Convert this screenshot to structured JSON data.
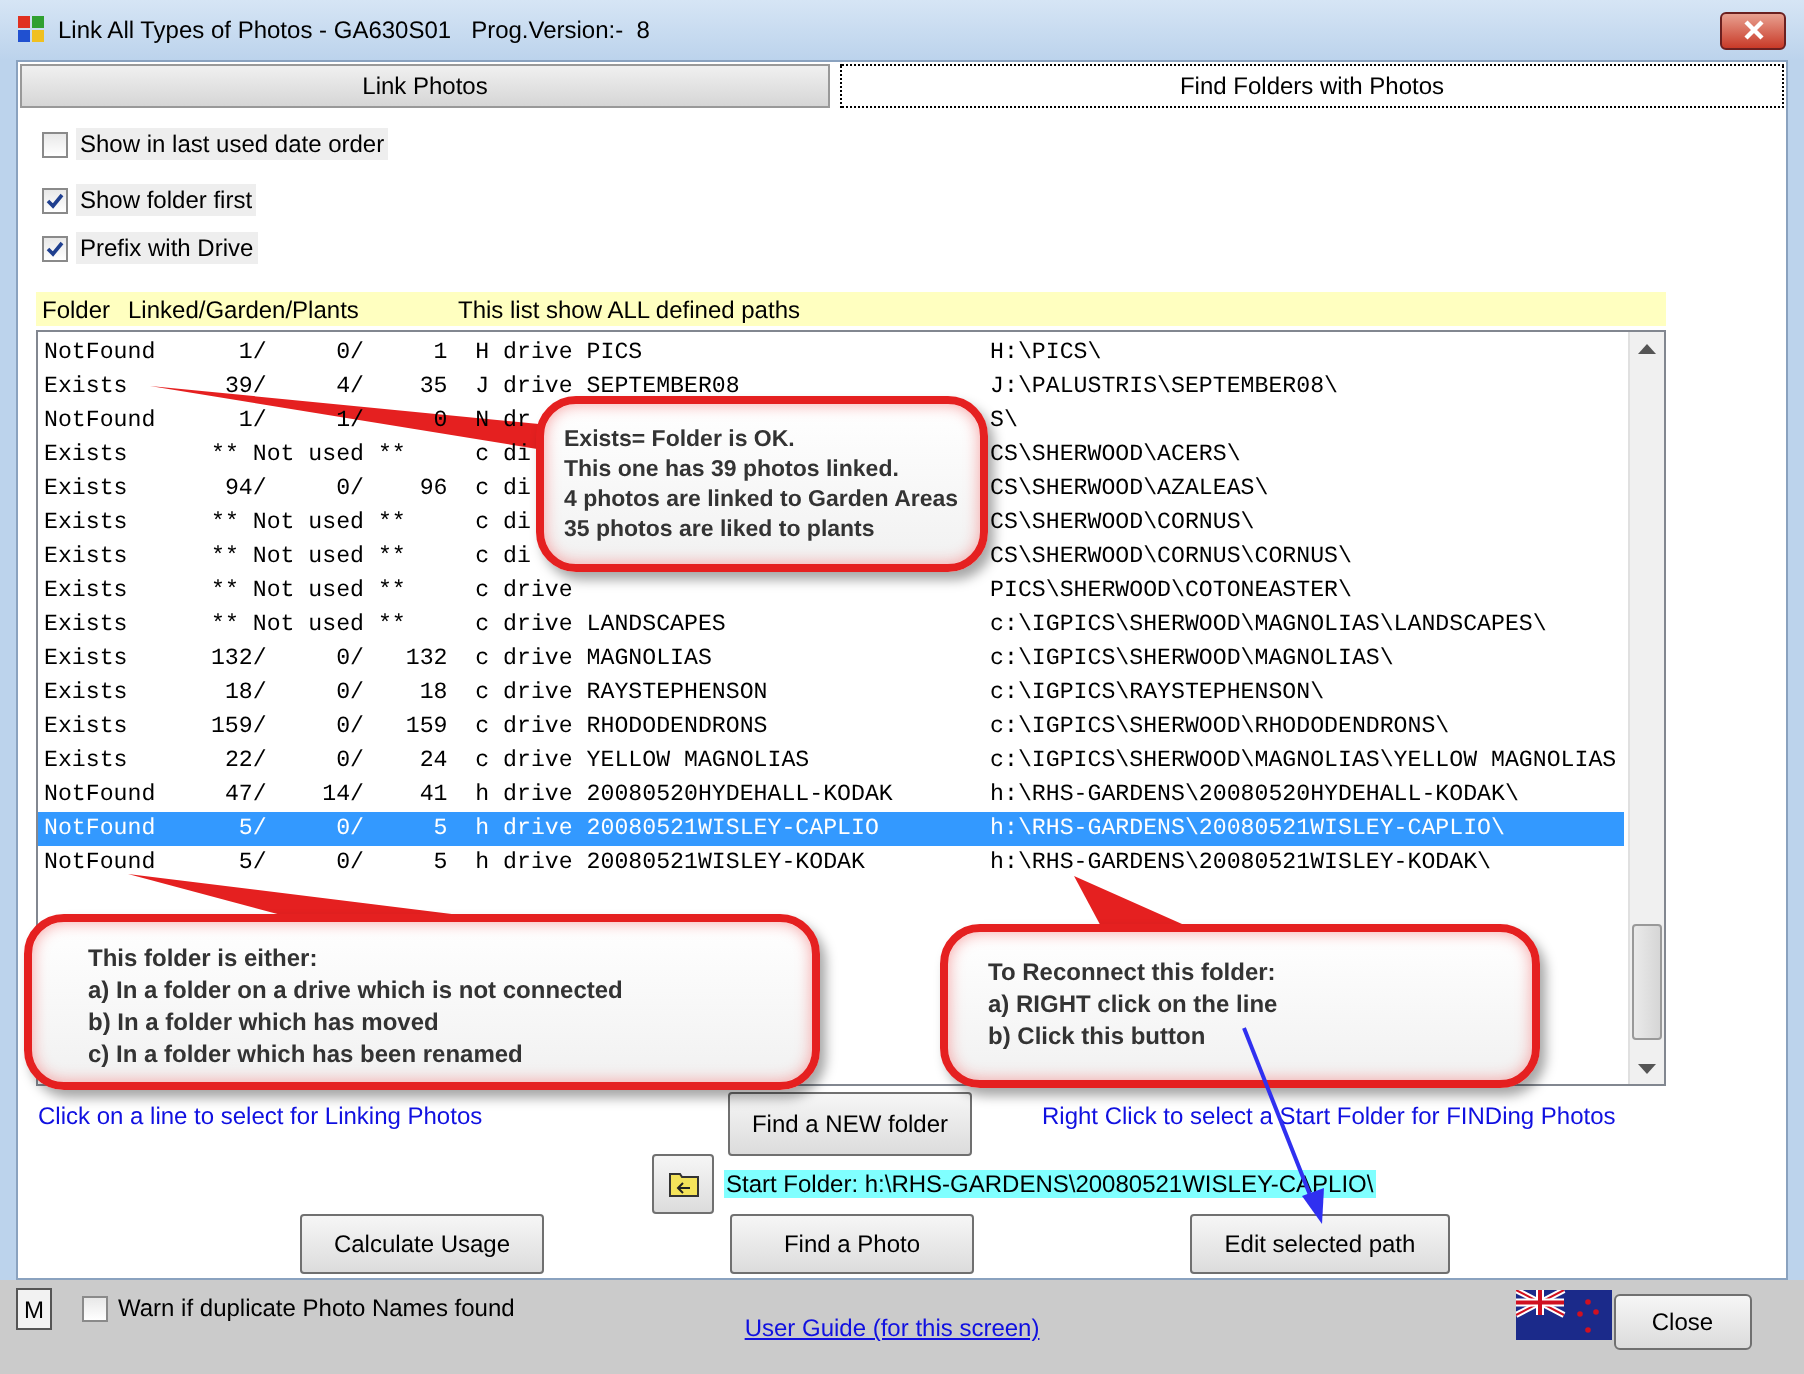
{
  "window": {
    "title": "Link All Types of Photos - GA630S01   Prog.Version:-  8"
  },
  "tabs": [
    {
      "label": "Link Photos",
      "selected": false
    },
    {
      "label": "Find Folders with Photos",
      "selected": true
    }
  ],
  "options": [
    {
      "label": "Show in last used date order",
      "checked": false
    },
    {
      "label": "Show folder first",
      "checked": true
    },
    {
      "label": "Prefix with Drive",
      "checked": true
    }
  ],
  "list_header": [
    "Folder",
    "Linked/Garden/Plants",
    "This list show ALL defined paths"
  ],
  "rows": [
    {
      "status": "NotFound",
      "linked": "1/",
      "garden": "0/",
      "plants": "1",
      "drive": "H drive",
      "folder": "PICS",
      "path": "H:\\PICS\\",
      "selected": false
    },
    {
      "status": "Exists",
      "linked": "39/",
      "garden": "4/",
      "plants": "35",
      "drive": "J drive",
      "folder": "SEPTEMBER08",
      "path": "J:\\PALUSTRIS\\SEPTEMBER08\\",
      "selected": false
    },
    {
      "status": "NotFound",
      "linked": "1/",
      "garden": "1/",
      "plants": "0",
      "drive": "N dr",
      "path": "S\\",
      "selected": false
    },
    {
      "status": "Exists",
      "note": "** Not used **",
      "drive": "c di",
      "path": "CS\\SHERWOOD\\ACERS\\",
      "selected": false
    },
    {
      "status": "Exists",
      "linked": "94/",
      "garden": "0/",
      "plants": "96",
      "drive": "c di",
      "path": "CS\\SHERWOOD\\AZALEAS\\",
      "selected": false
    },
    {
      "status": "Exists",
      "note": "** Not used **",
      "drive": "c di",
      "path": "CS\\SHERWOOD\\CORNUS\\",
      "selected": false
    },
    {
      "status": "Exists",
      "note": "** Not used **",
      "drive": "c di",
      "path": "CS\\SHERWOOD\\CORNUS\\CORNUS\\",
      "selected": false
    },
    {
      "status": "Exists",
      "note": "** Not used **",
      "drive": "c drive",
      "path": "PICS\\SHERWOOD\\COTONEASTER\\",
      "selected": false
    },
    {
      "status": "Exists",
      "note": "** Not used **",
      "drive": "c drive",
      "folder": "LANDSCAPES",
      "path": "c:\\IGPICS\\SHERWOOD\\MAGNOLIAS\\LANDSCAPES\\",
      "selected": false
    },
    {
      "status": "Exists",
      "linked": "132/",
      "garden": "0/",
      "plants": "132",
      "drive": "c drive",
      "folder": "MAGNOLIAS",
      "path": "c:\\IGPICS\\SHERWOOD\\MAGNOLIAS\\",
      "selected": false
    },
    {
      "status": "Exists",
      "linked": "18/",
      "garden": "0/",
      "plants": "18",
      "drive": "c drive",
      "folder": "RAYSTEPHENSON",
      "path": "c:\\IGPICS\\RAYSTEPHENSON\\",
      "selected": false
    },
    {
      "status": "Exists",
      "linked": "159/",
      "garden": "0/",
      "plants": "159",
      "drive": "c drive",
      "folder": "RHODODENDRONS",
      "path": "c:\\IGPICS\\SHERWOOD\\RHODODENDRONS\\",
      "selected": false
    },
    {
      "status": "Exists",
      "linked": "22/",
      "garden": "0/",
      "plants": "24",
      "drive": "c drive",
      "folder": "YELLOW MAGNOLIAS",
      "path": "c:\\IGPICS\\SHERWOOD\\MAGNOLIAS\\YELLOW MAGNOLIAS",
      "selected": false
    },
    {
      "status": "NotFound",
      "linked": "47/",
      "garden": "14/",
      "plants": "41",
      "drive": "h drive",
      "folder": "20080520HYDEHALL-KODAK",
      "path": "h:\\RHS-GARDENS\\20080520HYDEHALL-KODAK\\",
      "selected": false
    },
    {
      "status": "NotFound",
      "linked": "5/",
      "garden": "0/",
      "plants": "5",
      "drive": "h drive",
      "folder": "20080521WISLEY-CAPLIO",
      "path": "h:\\RHS-GARDENS\\20080521WISLEY-CAPLIO\\",
      "selected": true
    },
    {
      "status": "NotFound",
      "linked": "5/",
      "garden": "0/",
      "plants": "5",
      "drive": "h drive",
      "folder": "20080521WISLEY-KODAK",
      "path": "h:\\RHS-GARDENS\\20080521WISLEY-KODAK\\",
      "selected": false
    }
  ],
  "callouts": [
    {
      "lines": [
        "Exists= Folder is OK.",
        "This one has 39 photos linked.",
        "4 photos are linked to Garden Areas",
        "35 photos are liked to plants"
      ]
    },
    {
      "lines": [
        "This folder is either:",
        "a) In a folder on a drive which is not connected",
        "b) In a folder which has moved",
        "c) In a folder which has been renamed"
      ]
    },
    {
      "lines": [
        "To Reconnect this folder:",
        "a) RIGHT click on the line",
        "b) Click this button"
      ]
    }
  ],
  "hints": {
    "left": "Click on a line to select for Linking Photos",
    "right": "Right Click to select a Start Folder for FINDing Photos"
  },
  "find_new_button": "Find a NEW folder",
  "start_folder": "Start Folder: h:\\RHS-GARDENS\\20080521WISLEY-CAPLIO\\",
  "buttons": [
    "Calculate Usage",
    "Find a Photo",
    "Edit selected path"
  ],
  "footer": {
    "m_button": "M",
    "warn": {
      "label": "Warn if duplicate Photo Names found",
      "checked": false
    },
    "guide_link": "User Guide (for this screen)",
    "close_button": "Close"
  }
}
